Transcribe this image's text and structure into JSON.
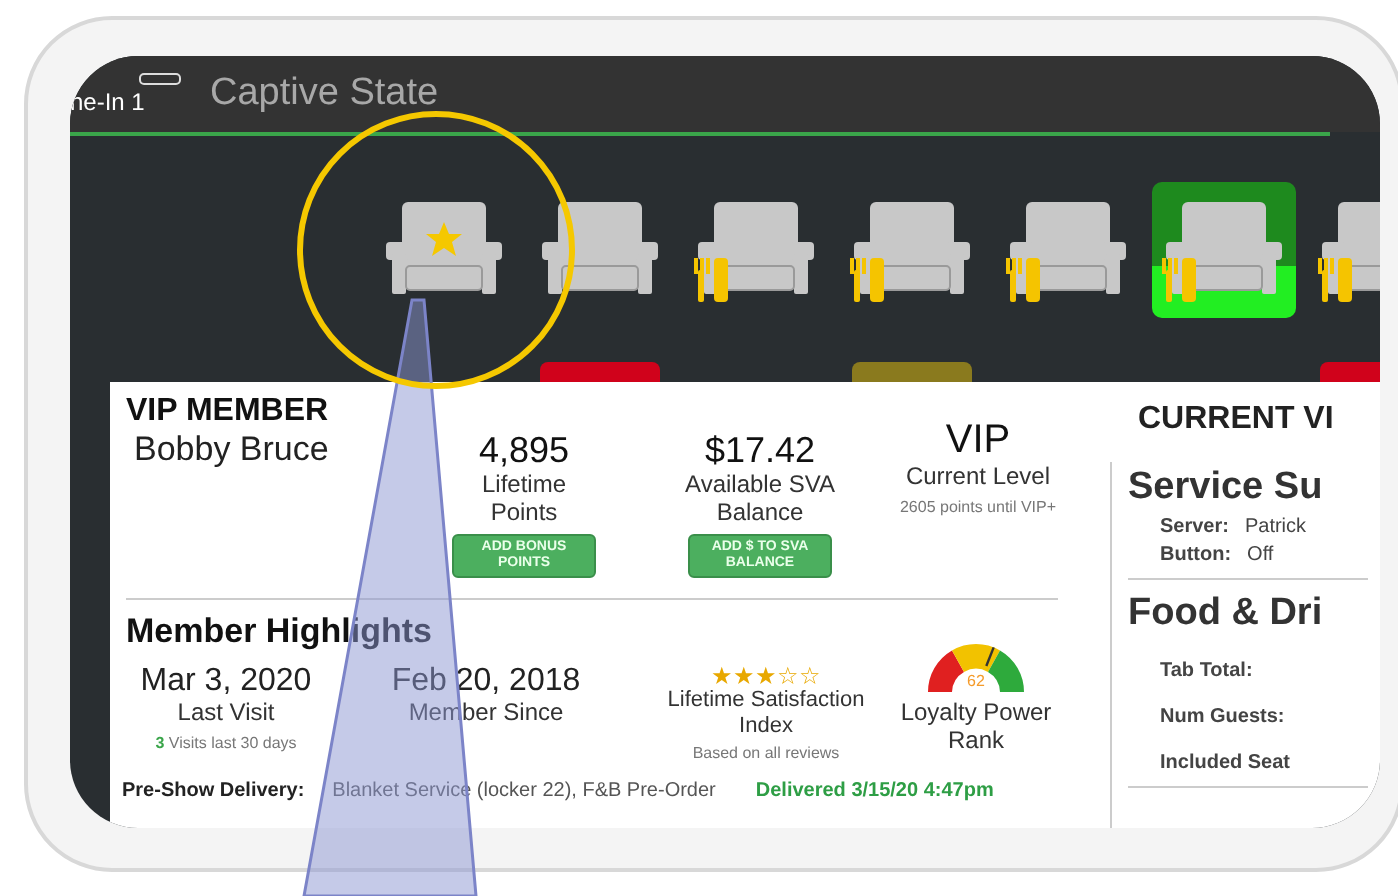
{
  "top_bar": {
    "lane": "ne-In 1",
    "title": "Captive State"
  },
  "seats": [
    {
      "kind": "vip",
      "selected": false
    },
    {
      "kind": "plain",
      "selected": false,
      "color": "#d0021b"
    },
    {
      "kind": "dining",
      "selected": false
    },
    {
      "kind": "dining",
      "selected": false,
      "color": "#8a7a1e"
    },
    {
      "kind": "dining",
      "selected": false
    },
    {
      "kind": "dining",
      "selected": true
    },
    {
      "kind": "dining",
      "selected": false,
      "color": "#d0021b"
    }
  ],
  "member": {
    "heading": "VIP MEMBER",
    "name": "Bobby Bruce"
  },
  "stats": [
    {
      "value": "4,895",
      "label": "Lifetime Points",
      "action": "ADD BONUS POINTS"
    },
    {
      "value": "$17.42",
      "label": "Available SVA Balance",
      "action": "ADD $ TO SVA BALANCE"
    },
    {
      "value": "VIP",
      "label": "Current Level",
      "note": "2605 points until VIP+"
    }
  ],
  "highlights": {
    "title": "Member Highlights",
    "last_visit": {
      "value": "Mar 3, 2020",
      "label": "Last Visit",
      "count": "3",
      "note": "Visits last 30 days"
    },
    "member_since": {
      "value": "Feb 20, 2018",
      "label": "Member Since"
    },
    "satisfaction": {
      "stars": 3,
      "label": "Lifetime Satisfaction Index",
      "note": "Based on all reviews"
    },
    "loyalty": {
      "level": 0.62,
      "reading": "62",
      "label": "Loyalty Power Rank"
    }
  },
  "pre_show": {
    "label": "Pre-Show Delivery:",
    "value": "Blanket Service (locker 22), F&B Pre-Order",
    "status": "Delivered 3/15/20 4:47pm"
  },
  "current": {
    "heading": "CURRENT VI",
    "service": {
      "title": "Service Su",
      "fields": [
        {
          "label": "Server:",
          "value": "Patrick"
        },
        {
          "label": "Button:",
          "value": "Off"
        }
      ]
    },
    "food": {
      "title": "Food & Dri",
      "fields": [
        {
          "label": "Tab Total:"
        },
        {
          "label": "Num Guests:"
        },
        {
          "label": "Included Seat"
        }
      ]
    }
  }
}
